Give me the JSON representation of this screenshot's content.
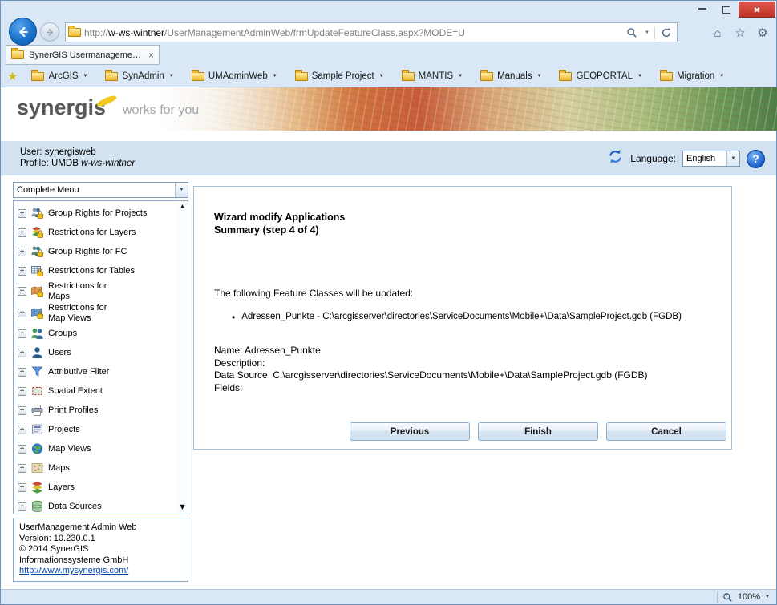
{
  "chrome": {
    "url": {
      "prefix": "http://",
      "host": "w-ws-wintner",
      "path": "/UserManagementAdminWeb/frmUpdateFeatureClass.aspx?MODE=U"
    },
    "tab_title": "SynerGIS Usermanagement ...",
    "favorites": [
      {
        "label": "ArcGIS"
      },
      {
        "label": "SynAdmin"
      },
      {
        "label": "UMAdminWeb"
      },
      {
        "label": "Sample Project"
      },
      {
        "label": "MANTIS"
      },
      {
        "label": "Manuals"
      },
      {
        "label": "GEOPORTAL"
      },
      {
        "label": "Migration"
      }
    ]
  },
  "banner": {
    "logo": "synergis",
    "tagline": "works for you"
  },
  "userbar": {
    "user_label": "User:",
    "user_value": "synergisweb",
    "profile_label": "Profile:",
    "profile_db": "UMDB",
    "profile_host": "w-ws-wintner",
    "language_label": "Language:",
    "language_value": "English"
  },
  "sidebar": {
    "menu_filter": "Complete Menu",
    "items": [
      {
        "label": "Group Rights for Projects",
        "icon": "group-rights-projects-icon"
      },
      {
        "label": "Restrictions for Layers",
        "icon": "restrictions-layers-icon"
      },
      {
        "label": "Group Rights for FC",
        "icon": "group-rights-fc-icon"
      },
      {
        "label": "Restrictions for Tables",
        "icon": "restrictions-tables-icon"
      },
      {
        "label": "Restrictions for Maps",
        "icon": "restrictions-maps-icon"
      },
      {
        "label": "Restrictions for Map Views",
        "icon": "restrictions-map-views-icon"
      },
      {
        "label": "Groups",
        "icon": "groups-icon"
      },
      {
        "label": "Users",
        "icon": "users-icon"
      },
      {
        "label": "Attributive Filter",
        "icon": "attributive-filter-icon"
      },
      {
        "label": "Spatial Extent",
        "icon": "spatial-extent-icon"
      },
      {
        "label": "Print Profiles",
        "icon": "print-profiles-icon"
      },
      {
        "label": "Projects",
        "icon": "projects-icon"
      },
      {
        "label": "Map Views",
        "icon": "map-views-icon"
      },
      {
        "label": "Maps",
        "icon": "maps-icon"
      },
      {
        "label": "Layers",
        "icon": "layers-icon"
      },
      {
        "label": "Data Sources",
        "icon": "data-sources-icon"
      }
    ],
    "about": {
      "title": "UserManagement Admin Web",
      "version": "Version: 10.230.0.1",
      "copyright1": "© 2014 SynerGIS",
      "copyright2": "Informationssysteme GmbH",
      "link": "http://www.mysynergis.com/"
    }
  },
  "wizard": {
    "title": "Wizard modify Applications",
    "subtitle": "Summary (step 4 of 4)",
    "intro": "The following Feature Classes will be updated:",
    "bullet": "Adressen_Punkte - C:\\arcgisserver\\directories\\ServiceDocuments\\Mobile+\\Data\\SampleProject.gdb (FGDB)",
    "detail_name": "Name: Adressen_Punkte",
    "detail_description": "Description:",
    "detail_data_source": "Data Source: C:\\arcgisserver\\directories\\ServiceDocuments\\Mobile+\\Data\\SampleProject.gdb (FGDB)",
    "detail_fields": "Fields:",
    "buttons": {
      "previous": "Previous",
      "finish": "Finish",
      "cancel": "Cancel"
    }
  },
  "status": {
    "zoom": "100%"
  }
}
